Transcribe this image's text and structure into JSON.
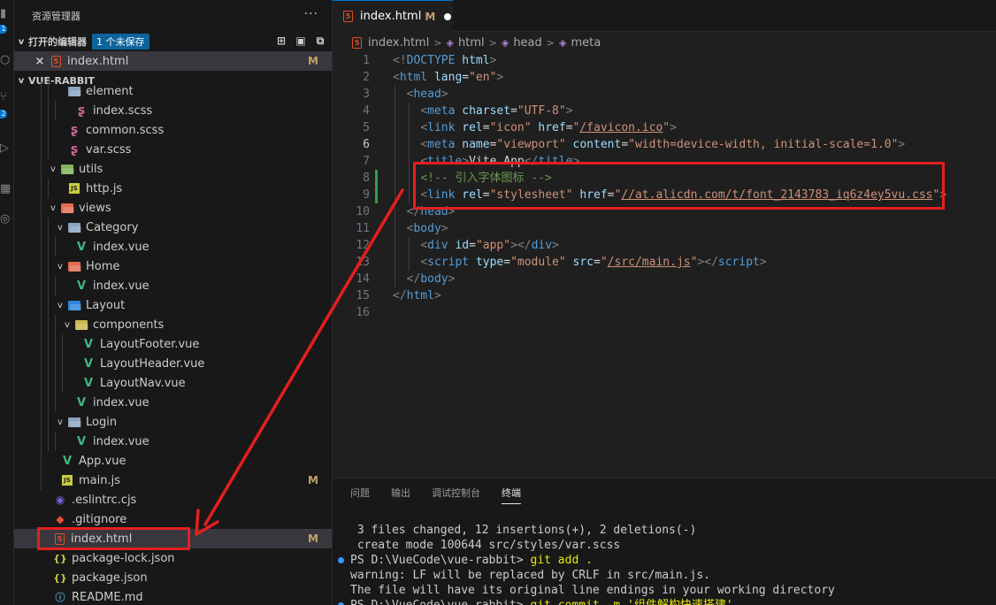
{
  "activity_bar": {
    "badges": [
      "1",
      "2"
    ]
  },
  "sidebar": {
    "title": "资源管理器",
    "more": "···",
    "open_editors": {
      "label": "打开的编辑器",
      "badge": "1 个未保存",
      "items": [
        {
          "label": "index.html",
          "status": "M"
        }
      ]
    },
    "project": {
      "label": "VUE-RABBIT",
      "rows": [
        {
          "label": "element",
          "icon": "folder-icon",
          "depth": 2,
          "chev": "",
          "kind": "folder"
        },
        {
          "label": "index.scss",
          "icon": "scss-icon",
          "depth": 3,
          "kind": "scss"
        },
        {
          "label": "common.scss",
          "icon": "scss-icon",
          "depth": 2,
          "kind": "scss"
        },
        {
          "label": "var.scss",
          "icon": "scss-icon",
          "depth": 2,
          "kind": "scss"
        },
        {
          "label": "utils",
          "icon": "folder-icon",
          "depth": 1,
          "chev": "v",
          "kind": "folder-utils"
        },
        {
          "label": "http.js",
          "icon": "js-icon",
          "depth": 2,
          "kind": "js"
        },
        {
          "label": "views",
          "icon": "folder-icon",
          "depth": 1,
          "chev": "v",
          "kind": "folder-views"
        },
        {
          "label": "Category",
          "icon": "folder-icon",
          "depth": 2,
          "chev": "v",
          "kind": "folder"
        },
        {
          "label": "index.vue",
          "icon": "vue-icon",
          "depth": 3,
          "kind": "vue"
        },
        {
          "label": "Home",
          "icon": "folder-icon",
          "depth": 2,
          "chev": "v",
          "kind": "folder-home"
        },
        {
          "label": "index.vue",
          "icon": "vue-icon",
          "depth": 3,
          "kind": "vue"
        },
        {
          "label": "Layout",
          "icon": "folder-icon",
          "depth": 2,
          "chev": "v",
          "kind": "folder-layout"
        },
        {
          "label": "components",
          "icon": "folder-icon",
          "depth": 3,
          "chev": "v",
          "kind": "folder-comp"
        },
        {
          "label": "LayoutFooter.vue",
          "icon": "vue-icon",
          "depth": 4,
          "kind": "vue"
        },
        {
          "label": "LayoutHeader.vue",
          "icon": "vue-icon",
          "depth": 4,
          "kind": "vue"
        },
        {
          "label": "LayoutNav.vue",
          "icon": "vue-icon",
          "depth": 4,
          "kind": "vue"
        },
        {
          "label": "index.vue",
          "icon": "vue-icon",
          "depth": 3,
          "kind": "vue"
        },
        {
          "label": "Login",
          "icon": "folder-icon",
          "depth": 2,
          "chev": "v",
          "kind": "folder"
        },
        {
          "label": "index.vue",
          "icon": "vue-icon",
          "depth": 3,
          "kind": "vue"
        },
        {
          "label": "App.vue",
          "icon": "vue-icon",
          "depth": 1,
          "kind": "vue"
        },
        {
          "label": "main.js",
          "icon": "js-icon",
          "depth": 1,
          "kind": "js",
          "status": "M"
        },
        {
          "label": ".eslintrc.cjs",
          "icon": "eslint-icon",
          "depth": 0,
          "kind": "eslint"
        },
        {
          "label": ".gitignore",
          "icon": "git-icon",
          "depth": 0,
          "kind": "git"
        },
        {
          "label": "index.html",
          "icon": "html-icon",
          "depth": 0,
          "kind": "html",
          "status": "M",
          "selected": true
        },
        {
          "label": "package-lock.json",
          "icon": "json-icon",
          "depth": 0,
          "kind": "json"
        },
        {
          "label": "package.json",
          "icon": "json-icon",
          "depth": 0,
          "kind": "json"
        },
        {
          "label": "README.md",
          "icon": "md-icon",
          "depth": 0,
          "kind": "md"
        }
      ]
    }
  },
  "editor": {
    "tab": {
      "label": "index.html",
      "status": "M"
    },
    "breadcrumb": [
      "index.html",
      "html",
      "head",
      "meta"
    ],
    "active_line": 6,
    "lines": [
      [
        [
          "punc",
          "<!"
        ],
        [
          "tag",
          "DOCTYPE"
        ],
        [
          "text",
          " "
        ],
        [
          "attr",
          "html"
        ],
        [
          "punc",
          ">"
        ]
      ],
      [
        [
          "punc",
          "<"
        ],
        [
          "tag",
          "html"
        ],
        [
          "text",
          " "
        ],
        [
          "attr",
          "lang"
        ],
        [
          "text",
          "="
        ],
        [
          "str",
          "\"en\""
        ],
        [
          "punc",
          ">"
        ]
      ],
      [
        [
          "text",
          "  "
        ],
        [
          "punc",
          "<"
        ],
        [
          "tag",
          "head"
        ],
        [
          "punc",
          ">"
        ]
      ],
      [
        [
          "text",
          "    "
        ],
        [
          "punc",
          "<"
        ],
        [
          "tag",
          "meta"
        ],
        [
          "text",
          " "
        ],
        [
          "attr",
          "charset"
        ],
        [
          "text",
          "="
        ],
        [
          "str",
          "\"UTF-8\""
        ],
        [
          "punc",
          ">"
        ]
      ],
      [
        [
          "text",
          "    "
        ],
        [
          "punc",
          "<"
        ],
        [
          "tag",
          "link"
        ],
        [
          "text",
          " "
        ],
        [
          "attr",
          "rel"
        ],
        [
          "text",
          "="
        ],
        [
          "str",
          "\"icon\""
        ],
        [
          "text",
          " "
        ],
        [
          "attr",
          "href"
        ],
        [
          "text",
          "="
        ],
        [
          "str",
          "\""
        ],
        [
          "strlink",
          "/favicon.ico"
        ],
        [
          "str",
          "\""
        ],
        [
          "punc",
          ">"
        ]
      ],
      [
        [
          "text",
          "    "
        ],
        [
          "punc",
          "<"
        ],
        [
          "tag",
          "meta"
        ],
        [
          "text",
          " "
        ],
        [
          "attr",
          "name"
        ],
        [
          "text",
          "="
        ],
        [
          "str",
          "\"viewport\""
        ],
        [
          "text",
          " "
        ],
        [
          "attr",
          "content"
        ],
        [
          "text",
          "="
        ],
        [
          "str",
          "\"width=device-width, initial-scale=1.0\""
        ],
        [
          "punc",
          ">"
        ]
      ],
      [
        [
          "text",
          "    "
        ],
        [
          "punc",
          "<"
        ],
        [
          "tag",
          "title"
        ],
        [
          "punc",
          ">"
        ],
        [
          "text",
          "Vite App"
        ],
        [
          "punc",
          "</"
        ],
        [
          "tag",
          "title"
        ],
        [
          "punc",
          ">"
        ]
      ],
      [
        [
          "text",
          "    "
        ],
        [
          "com",
          "<!-- 引入字体图标 -->"
        ]
      ],
      [
        [
          "text",
          "    "
        ],
        [
          "punc",
          "<"
        ],
        [
          "tag",
          "link"
        ],
        [
          "text",
          " "
        ],
        [
          "attr",
          "rel"
        ],
        [
          "text",
          "="
        ],
        [
          "str",
          "\"stylesheet\""
        ],
        [
          "text",
          " "
        ],
        [
          "attr",
          "href"
        ],
        [
          "text",
          "="
        ],
        [
          "str",
          "\""
        ],
        [
          "strlink",
          "//at.alicdn.com/t/font_2143783_iq6z4ey5vu.css"
        ],
        [
          "str",
          "\""
        ],
        [
          "punc",
          ">"
        ]
      ],
      [
        [
          "text",
          "  "
        ],
        [
          "punc",
          "</"
        ],
        [
          "tag",
          "head"
        ],
        [
          "punc",
          ">"
        ]
      ],
      [
        [
          "text",
          "  "
        ],
        [
          "punc",
          "<"
        ],
        [
          "tag",
          "body"
        ],
        [
          "punc",
          ">"
        ]
      ],
      [
        [
          "text",
          "    "
        ],
        [
          "punc",
          "<"
        ],
        [
          "tag",
          "div"
        ],
        [
          "text",
          " "
        ],
        [
          "attr",
          "id"
        ],
        [
          "text",
          "="
        ],
        [
          "str",
          "\"app\""
        ],
        [
          "punc",
          "></"
        ],
        [
          "tag",
          "div"
        ],
        [
          "punc",
          ">"
        ]
      ],
      [
        [
          "text",
          "    "
        ],
        [
          "punc",
          "<"
        ],
        [
          "tag",
          "script"
        ],
        [
          "text",
          " "
        ],
        [
          "attr",
          "type"
        ],
        [
          "text",
          "="
        ],
        [
          "str",
          "\"module\""
        ],
        [
          "text",
          " "
        ],
        [
          "attr",
          "src"
        ],
        [
          "text",
          "="
        ],
        [
          "str",
          "\""
        ],
        [
          "strlink",
          "/src/main.js"
        ],
        [
          "str",
          "\""
        ],
        [
          "punc",
          "></"
        ],
        [
          "tag",
          "script"
        ],
        [
          "punc",
          ">"
        ]
      ],
      [
        [
          "text",
          "  "
        ],
        [
          "punc",
          "</"
        ],
        [
          "tag",
          "body"
        ],
        [
          "punc",
          ">"
        ]
      ],
      [
        [
          "punc",
          "</"
        ],
        [
          "tag",
          "html"
        ],
        [
          "punc",
          ">"
        ]
      ],
      []
    ]
  },
  "panel": {
    "tabs": [
      "问题",
      "输出",
      "调试控制台",
      "终端"
    ],
    "active_tab": 3,
    "terminal": [
      {
        "text": " 3 files changed, 12 insertions(+), 2 deletions(-)"
      },
      {
        "text": " create mode 100644 src/styles/var.scss"
      },
      {
        "prompt": "PS D:\\VueCode\\vue-rabbit> ",
        "cmd": "git add .",
        "dot": true
      },
      {
        "text": "warning: LF will be replaced by CRLF in src/main.js."
      },
      {
        "text": "The file will have its original line endings in your working directory"
      },
      {
        "prompt": "PS D:\\VueCode\\vue-rabbit> ",
        "cmd": "git commit -m '组件解构快速搭建'",
        "dot": true
      }
    ]
  },
  "colors": {
    "annotation": "#e51f1f",
    "accent": "#0078d4"
  }
}
